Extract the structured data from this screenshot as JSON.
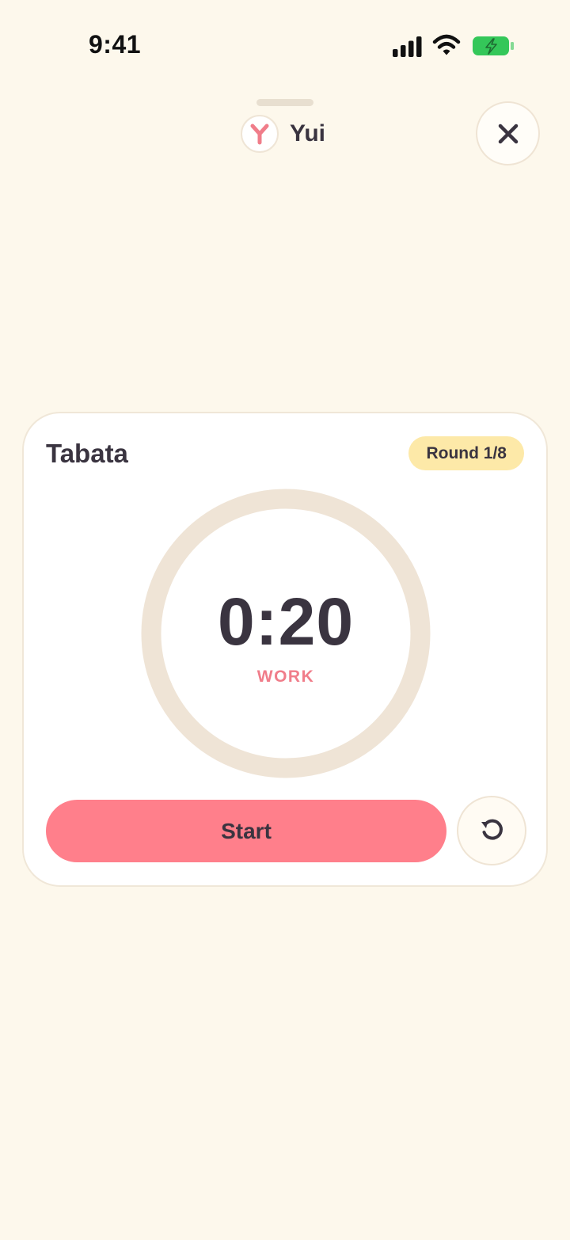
{
  "status_bar": {
    "time": "9:41",
    "icons": [
      "signal-icon",
      "wifi-icon",
      "battery-charging-icon"
    ],
    "battery_color": "#34C759"
  },
  "header": {
    "brand_icon": "yui-logo-icon",
    "brand_name": "Yui",
    "close_icon": "close-icon"
  },
  "timer": {
    "title": "Tabata",
    "round_badge": "Round 1/8",
    "time": "0:20",
    "phase": "WORK",
    "start_label": "Start",
    "reset_icon": "reset-icon",
    "accent_color": "#FF7F8B",
    "ring_color": "#EFE4D6",
    "badge_color": "#FDE9A8"
  }
}
